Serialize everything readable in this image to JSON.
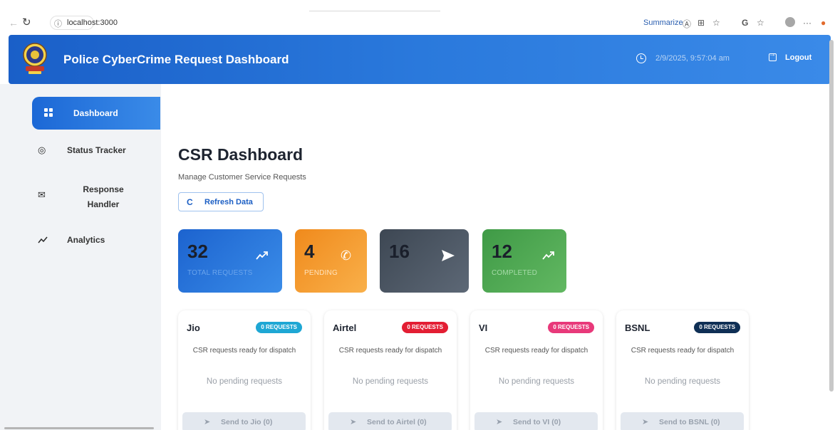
{
  "browser": {
    "url": "localhost:3000",
    "summarize_label": "Summarize",
    "icons": [
      "back-icon",
      "reload-icon",
      "info-icon",
      "reading-icon",
      "tabs-icon",
      "favorite-icon",
      "copilot-icon",
      "favorites-bar-icon",
      "profile-icon",
      "more-icon",
      "edge-icon"
    ]
  },
  "header": {
    "title": "Police CyberCrime Request Dashboard",
    "datetime": "2/9/2025, 9:57:04 am",
    "logout_label": "Logout"
  },
  "sidebar": {
    "items": [
      {
        "label": "Dashboard",
        "icon": "grid-icon",
        "active": true
      },
      {
        "label": "Status Tracker",
        "icon": "tracker-icon",
        "active": false
      },
      {
        "label": "Response Handler",
        "icon": "mail-icon",
        "active": false
      },
      {
        "label": "Analytics",
        "icon": "trend-icon",
        "active": false
      }
    ]
  },
  "main": {
    "title": "CSR Dashboard",
    "subtitle": "Manage Customer Service Requests",
    "refresh_label": "Refresh Data"
  },
  "stats": [
    {
      "value": "32",
      "label": "TOTAL REQUESTS",
      "icon": "trend-up-icon",
      "color": "#2774d9"
    },
    {
      "value": "4",
      "label": "PENDING",
      "icon": "phone-icon",
      "color": "#f39a2e"
    },
    {
      "value": "16",
      "label": "",
      "icon": "send-icon",
      "color": "#4a5663"
    },
    {
      "value": "12",
      "label": "COMPLETED",
      "icon": "trend-up-icon",
      "color": "#4aa653"
    }
  ],
  "providers": [
    {
      "name": "Jio",
      "badge": "0 REQUESTS",
      "badge_color": "#1ea7d4",
      "desc": "CSR requests ready for dispatch",
      "empty": "No pending requests",
      "send_label": "Send to Jio (0)"
    },
    {
      "name": "Airtel",
      "badge": "0 REQUESTS",
      "badge_color": "#e31e33",
      "desc": "CSR requests ready for dispatch",
      "empty": "No pending requests",
      "send_label": "Send to Airtel (0)"
    },
    {
      "name": "VI",
      "badge": "0 REQUESTS",
      "badge_color": "#e8397a",
      "desc": "CSR requests ready for dispatch",
      "empty": "No pending requests",
      "send_label": "Send to VI (0)"
    },
    {
      "name": "BSNL",
      "badge": "0 REQUESTS",
      "badge_color": "#0f2f55",
      "desc": "CSR requests ready for dispatch",
      "empty": "No pending requests",
      "send_label": "Send to BSNL (0)"
    }
  ]
}
